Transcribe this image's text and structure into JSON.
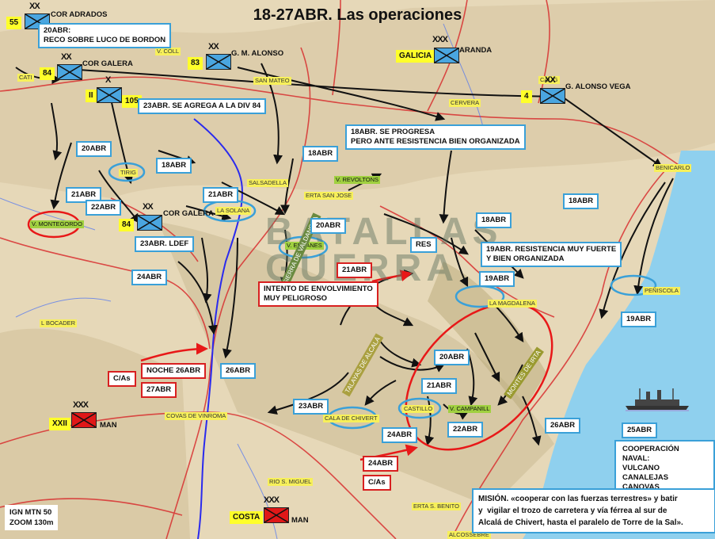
{
  "title": "18-27ABR. Las operaciones",
  "labels": {
    "reco": "20ABR:\nRECO SOBRE LUCO DE BORDON",
    "agrega": "23ABR. SE AGREGA A LA DIV 84",
    "progresa": "18ABR. SE PROGRESA\nPERO ANTE RESISTENCIA BIEN ORGANIZADA",
    "a20_1": "20ABR",
    "a18_1": "18ABR",
    "a18_2": "18ABR",
    "a21_1": "21ABR",
    "a21_2": "21ABR",
    "a22_1": "22ABR",
    "ldef": "23ABR. LDEF",
    "a20_2": "20ABR",
    "a24_1": "24ABR",
    "a18_3": "18ABR",
    "a18_4": "18ABR",
    "res": "RES",
    "a21_red": "21ABR",
    "intento": "INTENTO DE ENVOLVIMIENTO\nMUY PELIGROSO",
    "resist": "19ABR. RESISTENCIA MUY FUERTE\nY BIEN ORGANIZADA",
    "a19_1": "19ABR",
    "a19_2": "19ABR",
    "a20_3": "20ABR",
    "a21_3": "21ABR",
    "a26_1": "26ABR",
    "noche": "NOCHE 26ABR",
    "a27": "27ABR",
    "cas1": "C/As",
    "a23": "23ABR",
    "a22_2": "22ABR",
    "a26_2": "26ABR",
    "a24_2": "24ABR",
    "a24_red": "24ABR",
    "cas2": "C/As",
    "a25": "25ABR"
  },
  "units": {
    "u55": {
      "num": "55",
      "name": "COR ADRADOS",
      "echelon": "XX"
    },
    "u84a": {
      "num": "84",
      "name": "COR GALERA",
      "echelon": "XX"
    },
    "u83": {
      "num": "83",
      "name": "G. M. ALONSO",
      "echelon": "XX"
    },
    "galicia": {
      "num": "GALICIA",
      "name": "ARANDA",
      "echelon": "XXX"
    },
    "u4": {
      "num": "4",
      "name": "G. ALONSO VEGA",
      "echelon": "XX"
    },
    "u105": {
      "num": "105",
      "pre": "II",
      "echelon": "X"
    },
    "u84b": {
      "num": "84",
      "name": "COR GALERA",
      "echelon": "XX"
    },
    "xxii": {
      "num": "XXII",
      "name": "MAN",
      "echelon": "XXX"
    },
    "costa": {
      "num": "COSTA",
      "name": "MAN",
      "echelon": "XXX"
    }
  },
  "places": {
    "coll": "V. COLL",
    "cati": "CATI",
    "mateo": "SAN MATEO",
    "cervera": "CERVERA",
    "calig": "CALIG",
    "tirig": "TIRIG",
    "salsadella": "SALSADELLA",
    "revoltons": "V. REVOLTONS",
    "sanjose": "ERTA SAN JOSE",
    "benicarlo": "BENICARLO",
    "montegordo": "V. MONTEGORDO",
    "solana": "LA SOLANA",
    "encanes": "V. ENCANES",
    "peniscola": "PEÑISCOLA",
    "magdalena": "LA MAGDALENA",
    "bocader": "L BOCADER",
    "covas": "COVAS DE VINROMA",
    "chivert": "CALA DE CHIVERT",
    "castillo": "CASTILLO",
    "campanill": "V. CAMPANILL",
    "miguel": "RIO S. MIGUEL",
    "benito": "ERTA S. BENITO",
    "alcossebre": "ALCOSSEBRE",
    "irta": "MONTES DE IRTA",
    "talayas": "TALAYAS DE ALCALÁ",
    "sierra": "SIERRA DE VALDANCHA"
  },
  "watermark": "BATALLAS\nGUERRA",
  "mission": "MISIÓN. «cooperar con las fuerzas terrestres» y batir\ny  vigilar el trozo de carretera y vía férrea al sur de\nAlcalá de Chivert, hasta el paralelo de Torre de la Sal».",
  "naval": {
    "head": "COOPERACIÓN NAVAL:",
    "ships": [
      "VULCANO",
      "CANALEJAS",
      "CANOVAS"
    ]
  },
  "ign": "IGN MTN 50\nZOOM 130m",
  "colors": {
    "friendly": "#4aa6e0",
    "enemy": "#e01818",
    "label_border": "#3aa0d8",
    "unit_tag": "#ffff2a",
    "coast_water": "#8fd0ee"
  }
}
